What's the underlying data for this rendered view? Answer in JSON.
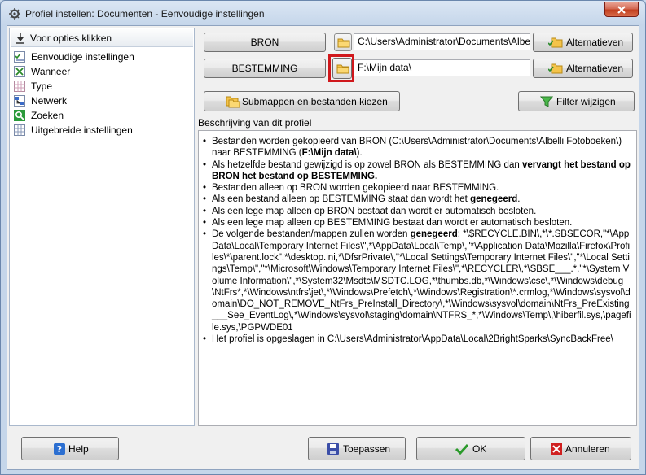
{
  "window": {
    "title": "Profiel instellen: Documenten - Eenvoudige instellingen",
    "close_label": "x"
  },
  "sidebar": {
    "header": "Voor opties klikken",
    "items": [
      {
        "label": "Eenvoudige instellingen",
        "icon": "check-list-icon"
      },
      {
        "label": "Wanneer",
        "icon": "calendar-icon"
      },
      {
        "label": "Type",
        "icon": "type-grid-icon"
      },
      {
        "label": "Netwerk",
        "icon": "network-icon"
      },
      {
        "label": "Zoeken",
        "icon": "search-icon"
      },
      {
        "label": "Uitgebreide instellingen",
        "icon": "settings-grid-icon"
      }
    ]
  },
  "source": {
    "button": "BRON",
    "path": "C:\\Users\\Administrator\\Documents\\Albelli",
    "alt_button": "Alternatieven"
  },
  "destination": {
    "button": "BESTEMMING",
    "path": "F:\\Mijn data\\",
    "alt_button": "Alternatieven"
  },
  "actions": {
    "submaps": "Submappen en bestanden kiezen",
    "filter": "Filter wijzigen"
  },
  "description": {
    "title": "Beschrijving van dit profiel",
    "b1_pre": "Bestanden worden gekopieerd van BRON (C:\\Users\\Administrator\\Documents\\Albelli Fotoboeken\\) naar BESTEMMING (",
    "b1_bold": "F:\\Mijn data\\",
    "b1_post": ").",
    "b2_pre": "Als hetzelfde bestand gewijzigd is op zowel BRON als BESTEMMING dan ",
    "b2_bold": "vervangt het bestand op BRON het bestand op BESTEMMING.",
    "b3": "Bestanden alleen op BRON worden gekopieerd naar BESTEMMING.",
    "b4_pre": "Als een bestand alleen op BESTEMMING staat dan wordt het ",
    "b4_bold": "genegeerd",
    "b4_post": ".",
    "b5": "Als een lege map alleen op BRON bestaat dan wordt er automatisch besloten.",
    "b6": "Als een lege map alleen op BESTEMMING bestaat dan wordt er automatisch besloten.",
    "b7_pre": "De volgende bestanden/mappen zullen worden ",
    "b7_bold": "genegeerd",
    "b7_post": ": *\\$RECYCLE.BIN\\,*\\*.SBSECOR,\"*\\AppData\\Local\\Temporary Internet Files\\\",*\\AppData\\Local\\Temp\\,\"*\\Application Data\\Mozilla\\Firefox\\Profiles\\*\\parent.lock\",*\\desktop.ini,*\\DfsrPrivate\\,\"*\\Local Settings\\Temporary Internet Files\\\",\"*\\Local Settings\\Temp\\\",\"*\\Microsoft\\Windows\\Temporary Internet Files\\\",*\\RECYCLER\\,*\\SBSE___.*,\"*\\System Volume Information\\\",*\\System32\\Msdtc\\MSDTC.LOG,*\\thumbs.db,*\\Windows\\csc\\,*\\Windows\\debug\\NtFrs*,*\\Windows\\ntfrs\\jet\\,*\\Windows\\Prefetch\\,*\\Windows\\Registration\\*.crmlog,*\\Windows\\sysvol\\domain\\DO_NOT_REMOVE_NtFrs_PreInstall_Directory\\,*\\Windows\\sysvol\\domain\\NtFrs_PreExisting___See_EventLog\\,*\\Windows\\sysvol\\staging\\domain\\NTFRS_*,*\\Windows\\Temp\\,\\hiberfil.sys,\\pagefile.sys,\\PGPWDE01",
    "b8": "Het profiel is opgeslagen in C:\\Users\\Administrator\\AppData\\Local\\2BrightSparks\\SyncBackFree\\"
  },
  "footer": {
    "help": "Help",
    "apply": "Toepassen",
    "ok": "OK",
    "cancel": "Annuleren"
  },
  "colors": {
    "highlight": "#d0181c",
    "title_bar": "#c5d6ea"
  }
}
